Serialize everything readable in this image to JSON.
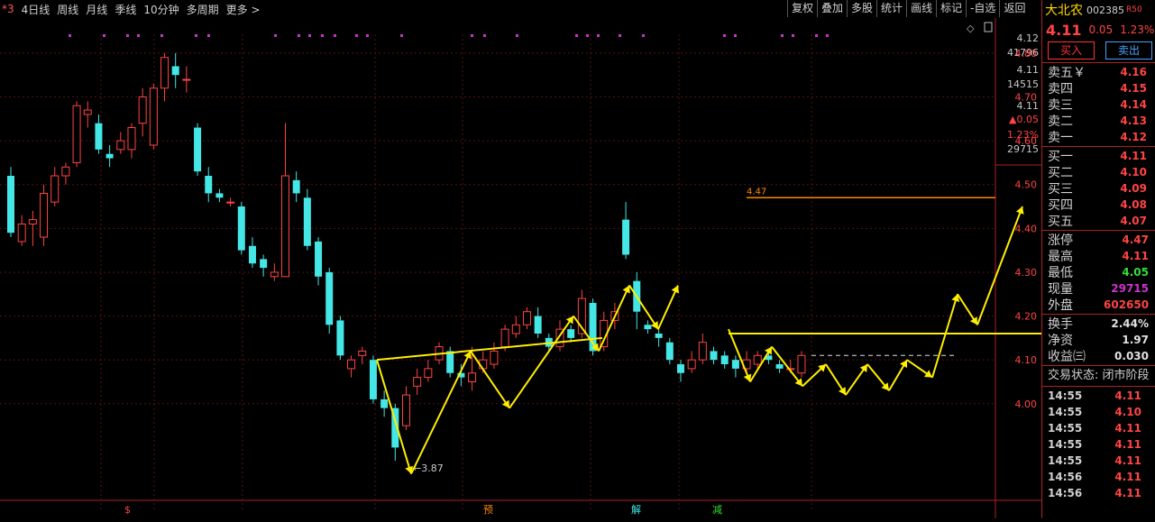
{
  "toolbar": {
    "tabs": [
      "*3",
      "4日线",
      "周线",
      "月线",
      "季线",
      "10分钟",
      "多周期",
      "更多 >"
    ],
    "tools": [
      "复权",
      "叠加",
      "多股",
      "统计",
      "画线",
      "标记",
      "-自选",
      "返回"
    ]
  },
  "stock": {
    "name": "大北农",
    "code": "002385",
    "market": "R50",
    "price": "4.11",
    "change": "0.05",
    "change_pct": "1.23%",
    "buy_label": "买入",
    "sell_label": "卖出"
  },
  "asks": [
    {
      "label": "卖五￥",
      "price": "4.16"
    },
    {
      "label": "卖四",
      "price": "4.15"
    },
    {
      "label": "卖三",
      "price": "4.14"
    },
    {
      "label": "卖二",
      "price": "4.13"
    },
    {
      "label": "卖一",
      "price": "4.12"
    }
  ],
  "bids": [
    {
      "label": "买一",
      "price": "4.11"
    },
    {
      "label": "买二",
      "price": "4.10"
    },
    {
      "label": "买三",
      "price": "4.09"
    },
    {
      "label": "买四",
      "price": "4.08"
    },
    {
      "label": "买五",
      "price": "4.07"
    }
  ],
  "stats1": [
    {
      "label": "涨停",
      "value": "4.47",
      "color": "#ff4444"
    },
    {
      "label": "最高",
      "value": "4.11",
      "color": "#ff4444"
    },
    {
      "label": "最低",
      "value": "4.05",
      "color": "#33dd33"
    },
    {
      "label": "现量",
      "value": "29715",
      "color": "#cc33cc"
    },
    {
      "label": "外盘",
      "value": "602650",
      "color": "#ff4444"
    }
  ],
  "stats2": [
    {
      "label": "换手",
      "value": "2.44%",
      "color": "#e0e0e0"
    },
    {
      "label": "净资",
      "value": "1.97",
      "color": "#e0e0e0"
    },
    {
      "label": "收益㈢",
      "value": "0.030",
      "color": "#e0e0e0"
    }
  ],
  "trade_status": "交易状态: 闭市阶段",
  "ticks": [
    {
      "time": "14:55",
      "price": "4.11"
    },
    {
      "time": "14:55",
      "price": "4.10"
    },
    {
      "time": "14:55",
      "price": "4.11"
    },
    {
      "time": "14:55",
      "price": "4.11"
    },
    {
      "time": "14:55",
      "price": "4.11"
    },
    {
      "time": "14:56",
      "price": "4.11"
    },
    {
      "time": "14:56",
      "price": "4.11"
    }
  ],
  "axis": {
    "top_labels": [
      "4.12",
      "41796",
      "4.11",
      "14515",
      "4.11",
      "▲0.05",
      "1.23%",
      "29715"
    ],
    "price_ticks": [
      "4.80",
      "4.70",
      "4.60",
      "4.50",
      "4.40",
      "4.30",
      "4.20",
      "4.10",
      "4.00"
    ]
  },
  "chart_data": {
    "type": "candlestick",
    "ylim": [
      3.8,
      4.88
    ],
    "annotations": {
      "low_label": "3.87",
      "limit_line_label": "4.47",
      "markers": [
        "$",
        "预",
        "解",
        "减"
      ]
    },
    "candles": [
      {
        "o": 4.52,
        "c": 4.39,
        "h": 4.54,
        "l": 4.38
      },
      {
        "o": 4.37,
        "c": 4.41,
        "h": 4.43,
        "l": 4.36
      },
      {
        "o": 4.41,
        "c": 4.42,
        "h": 4.44,
        "l": 4.36
      },
      {
        "o": 4.38,
        "c": 4.48,
        "h": 4.5,
        "l": 4.36
      },
      {
        "o": 4.46,
        "c": 4.52,
        "h": 4.54,
        "l": 4.45
      },
      {
        "o": 4.52,
        "c": 4.54,
        "h": 4.55,
        "l": 4.5
      },
      {
        "o": 4.55,
        "c": 4.68,
        "h": 4.69,
        "l": 4.54
      },
      {
        "o": 4.66,
        "c": 4.67,
        "h": 4.69,
        "l": 4.63
      },
      {
        "o": 4.64,
        "c": 4.58,
        "h": 4.66,
        "l": 4.57
      },
      {
        "o": 4.57,
        "c": 4.56,
        "h": 4.59,
        "l": 4.54
      },
      {
        "o": 4.58,
        "c": 4.6,
        "h": 4.62,
        "l": 4.57
      },
      {
        "o": 4.58,
        "c": 4.63,
        "h": 4.64,
        "l": 4.56
      },
      {
        "o": 4.64,
        "c": 4.7,
        "h": 4.72,
        "l": 4.61
      },
      {
        "o": 4.59,
        "c": 4.72,
        "h": 4.73,
        "l": 4.58
      },
      {
        "o": 4.72,
        "c": 4.79,
        "h": 4.8,
        "l": 4.69
      },
      {
        "o": 4.77,
        "c": 4.75,
        "h": 4.8,
        "l": 4.72
      },
      {
        "o": 4.74,
        "c": 4.74,
        "h": 4.77,
        "l": 4.71
      },
      {
        "o": 4.63,
        "c": 4.53,
        "h": 4.64,
        "l": 4.52
      },
      {
        "o": 4.52,
        "c": 4.48,
        "h": 4.54,
        "l": 4.46
      },
      {
        "o": 4.48,
        "c": 4.47,
        "h": 4.49,
        "l": 4.46
      },
      {
        "o": 4.46,
        "c": 4.46,
        "h": 4.47,
        "l": 4.45
      },
      {
        "o": 4.45,
        "c": 4.35,
        "h": 4.46,
        "l": 4.34
      },
      {
        "o": 4.36,
        "c": 4.32,
        "h": 4.38,
        "l": 4.31
      },
      {
        "o": 4.33,
        "c": 4.31,
        "h": 4.34,
        "l": 4.29
      },
      {
        "o": 4.29,
        "c": 4.3,
        "h": 4.32,
        "l": 4.28
      },
      {
        "o": 4.29,
        "c": 4.52,
        "h": 4.64,
        "l": 4.29
      },
      {
        "o": 4.51,
        "c": 4.48,
        "h": 4.53,
        "l": 4.46
      },
      {
        "o": 4.47,
        "c": 4.36,
        "h": 4.49,
        "l": 4.35
      },
      {
        "o": 4.37,
        "c": 4.29,
        "h": 4.38,
        "l": 4.27
      },
      {
        "o": 4.3,
        "c": 4.18,
        "h": 4.31,
        "l": 4.16
      },
      {
        "o": 4.19,
        "c": 4.11,
        "h": 4.2,
        "l": 4.1
      },
      {
        "o": 4.08,
        "c": 4.1,
        "h": 4.11,
        "l": 4.06
      },
      {
        "o": 4.11,
        "c": 4.12,
        "h": 4.13,
        "l": 4.09
      },
      {
        "o": 4.1,
        "c": 4.01,
        "h": 4.11,
        "l": 4.0
      },
      {
        "o": 4.01,
        "c": 3.99,
        "h": 4.03,
        "l": 3.97
      },
      {
        "o": 3.99,
        "c": 3.9,
        "h": 4.0,
        "l": 3.87
      },
      {
        "o": 3.95,
        "c": 4.02,
        "h": 4.04,
        "l": 3.94
      },
      {
        "o": 4.04,
        "c": 4.06,
        "h": 4.08,
        "l": 4.02
      },
      {
        "o": 4.06,
        "c": 4.08,
        "h": 4.1,
        "l": 4.05
      },
      {
        "o": 4.1,
        "c": 4.13,
        "h": 4.14,
        "l": 4.09
      },
      {
        "o": 4.12,
        "c": 4.07,
        "h": 4.13,
        "l": 4.06
      },
      {
        "o": 4.07,
        "c": 4.06,
        "h": 4.09,
        "l": 4.04
      },
      {
        "o": 4.05,
        "c": 4.07,
        "h": 4.13,
        "l": 4.03
      },
      {
        "o": 4.08,
        "c": 4.1,
        "h": 4.12,
        "l": 4.07
      },
      {
        "o": 4.09,
        "c": 4.12,
        "h": 4.14,
        "l": 4.08
      },
      {
        "o": 4.13,
        "c": 4.17,
        "h": 4.18,
        "l": 4.12
      },
      {
        "o": 4.16,
        "c": 4.18,
        "h": 4.2,
        "l": 4.15
      },
      {
        "o": 4.18,
        "c": 4.21,
        "h": 4.22,
        "l": 4.17
      },
      {
        "o": 4.2,
        "c": 4.16,
        "h": 4.22,
        "l": 4.15
      },
      {
        "o": 4.15,
        "c": 4.13,
        "h": 4.16,
        "l": 4.12
      },
      {
        "o": 4.13,
        "c": 4.17,
        "h": 4.19,
        "l": 4.12
      },
      {
        "o": 4.17,
        "c": 4.15,
        "h": 4.18,
        "l": 4.14
      },
      {
        "o": 4.16,
        "c": 4.24,
        "h": 4.26,
        "l": 4.15
      },
      {
        "o": 4.23,
        "c": 4.12,
        "h": 4.24,
        "l": 4.11
      },
      {
        "o": 4.13,
        "c": 4.19,
        "h": 4.21,
        "l": 4.12
      },
      {
        "o": 4.19,
        "c": 4.21,
        "h": 4.23,
        "l": 4.17
      },
      {
        "o": 4.42,
        "c": 4.34,
        "h": 4.46,
        "l": 4.33
      },
      {
        "o": 4.28,
        "c": 4.21,
        "h": 4.3,
        "l": 4.17
      },
      {
        "o": 4.18,
        "c": 4.17,
        "h": 4.19,
        "l": 4.16
      },
      {
        "o": 4.16,
        "c": 4.15,
        "h": 4.17,
        "l": 4.13
      },
      {
        "o": 4.14,
        "c": 4.1,
        "h": 4.15,
        "l": 4.09
      },
      {
        "o": 4.09,
        "c": 4.07,
        "h": 4.1,
        "l": 4.05
      },
      {
        "o": 4.08,
        "c": 4.1,
        "h": 4.12,
        "l": 4.07
      },
      {
        "o": 4.1,
        "c": 4.14,
        "h": 4.16,
        "l": 4.09
      },
      {
        "o": 4.12,
        "c": 4.1,
        "h": 4.13,
        "l": 4.09
      },
      {
        "o": 4.11,
        "c": 4.09,
        "h": 4.12,
        "l": 4.08
      },
      {
        "o": 4.1,
        "c": 4.08,
        "h": 4.11,
        "l": 4.06
      },
      {
        "o": 4.08,
        "c": 4.1,
        "h": 4.12,
        "l": 4.07
      },
      {
        "o": 4.09,
        "c": 4.11,
        "h": 4.12,
        "l": 4.08
      },
      {
        "o": 4.11,
        "c": 4.1,
        "h": 4.12,
        "l": 4.09
      },
      {
        "o": 4.09,
        "c": 4.08,
        "h": 4.1,
        "l": 4.07
      },
      {
        "o": 4.08,
        "c": 4.08,
        "h": 4.1,
        "l": 4.07
      },
      {
        "o": 4.07,
        "c": 4.11,
        "h": 4.12,
        "l": 4.06
      }
    ],
    "zigzag": [
      [
        3.84,
        "l"
      ]
    ]
  }
}
